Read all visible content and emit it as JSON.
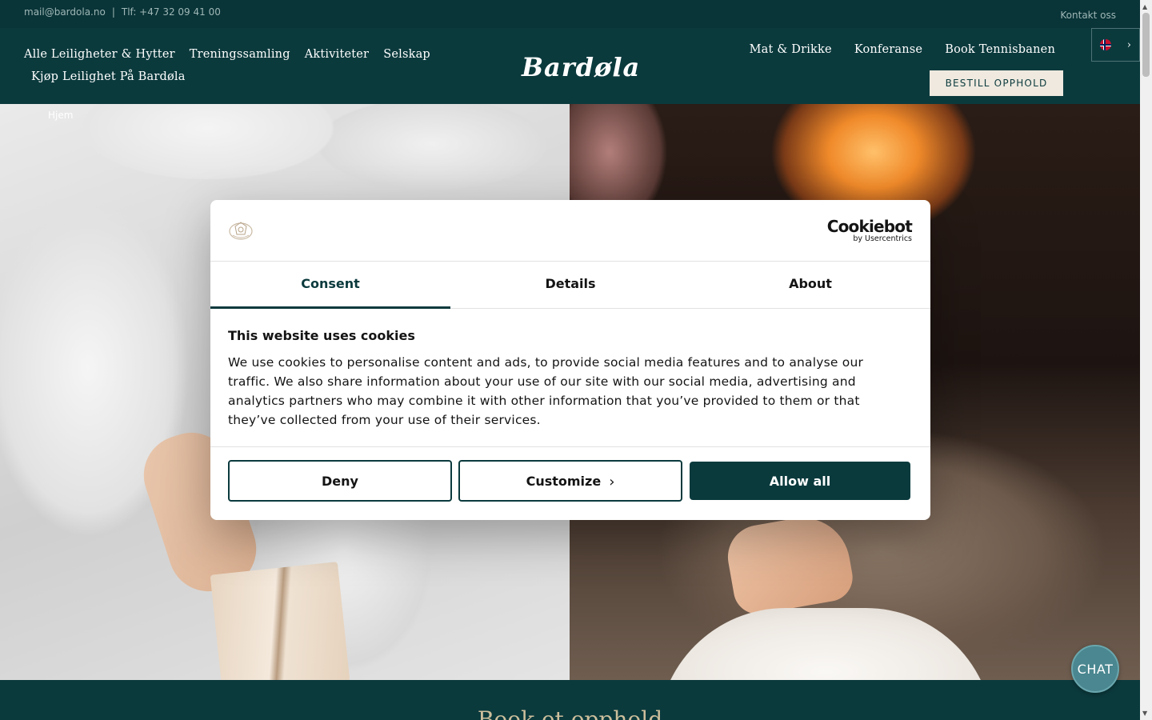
{
  "topbar": {
    "email": "mail@bardola.no",
    "separator": "|",
    "phone": "Tlf: +47 32 09 41 00",
    "contact_link": "Kontakt oss"
  },
  "nav": {
    "left_row1": [
      "Alle Leiligheter & Hytter",
      "Treningssamling",
      "Aktiviteter",
      "Selskap"
    ],
    "left_row2": "Kjøp Leilighet På Bardøla",
    "logo": "Bardøla",
    "right": [
      "Mat & Drikke",
      "Konferanse",
      "Book Tennisbanen"
    ],
    "book_button": "BESTILL OPPHOLD",
    "language_icon": "uk-flag-icon"
  },
  "breadcrumb": "Hjem",
  "bottom_title": "Book et opphold",
  "cookie_dialog": {
    "brand_main": "Cookiebot",
    "brand_sub": "by Usercentrics",
    "tabs": [
      "Consent",
      "Details",
      "About"
    ],
    "active_tab": "Consent",
    "heading": "This website uses cookies",
    "body": "We use cookies to personalise content and ads, to provide social media features and to analyse our traffic. We also share information about your use of our site with our social media, advertising and analytics partners who may combine it with other information that you’ve provided to them or that they’ve collected from your use of their services.",
    "deny_label": "Deny",
    "customize_label": "Customize",
    "allow_label": "Allow all",
    "accent_color": "#0b3a3d"
  },
  "chat_label": "CHAT",
  "colors": {
    "brand_dark": "#0b3a3d",
    "topbar": "#093438",
    "cta_bg": "#efe9df",
    "chat": "#4a8790",
    "title_gold": "#cdbf9c"
  }
}
